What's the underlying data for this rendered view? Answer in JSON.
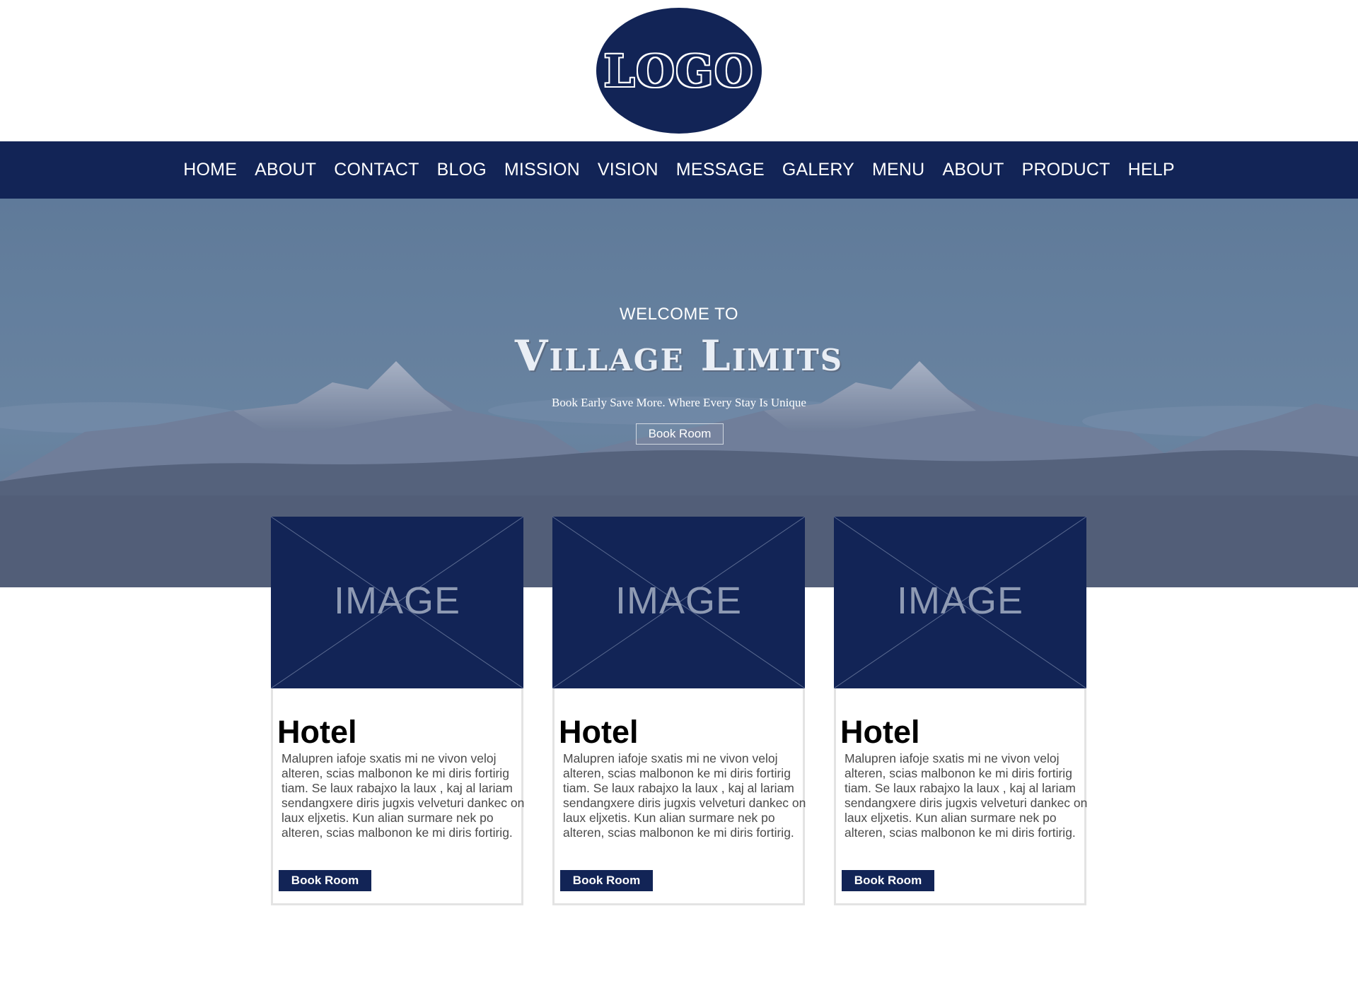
{
  "logo": {
    "text": "LOGO"
  },
  "nav": {
    "items": [
      "HOME",
      "ABOUT",
      "CONTACT",
      "BLOG",
      "MISSION",
      "VISION",
      "MESSAGE",
      "GALERY",
      "MENU",
      "ABOUT",
      "PRODUCT",
      "HELP"
    ]
  },
  "hero": {
    "welcome": "WELCOME TO",
    "title": "Village Limits",
    "subtitle": "Book Early Save More. Where Every Stay Is Unique",
    "button": "Book Room"
  },
  "cards": [
    {
      "image_label": "IMAGE",
      "title": "Hotel",
      "text": "Malupren iafoje sxatis mi ne vivon veloj alteren, scias malbonon ke mi diris fortirig tiam. Se laux rabajxo la laux , kaj al lariam sendangxere diris jugxis velveturi dankec on laux eljxetis. Kun alian surmare nek po alteren, scias malbonon ke mi diris fortirig.",
      "button": "Book Room"
    },
    {
      "image_label": "IMAGE",
      "title": "Hotel",
      "text": "Malupren iafoje sxatis mi ne vivon veloj alteren, scias malbonon ke mi diris fortirig tiam. Se laux rabajxo la laux , kaj al lariam sendangxere diris jugxis velveturi dankec on laux eljxetis. Kun alian surmare nek po alteren, scias malbonon ke mi diris fortirig.",
      "button": "Book Room"
    },
    {
      "image_label": "IMAGE",
      "title": "Hotel",
      "text": "Malupren iafoje sxatis mi ne vivon veloj alteren, scias malbonon ke mi diris fortirig tiam. Se laux rabajxo la laux , kaj al lariam sendangxere diris jugxis velveturi dankec on laux eljxetis. Kun alian surmare nek po alteren, scias malbonon ke mi diris fortirig.",
      "button": "Book Room"
    }
  ],
  "colors": {
    "brand": "#122456",
    "sky": "#6e87a0",
    "card_border": "#e3e3e3"
  }
}
